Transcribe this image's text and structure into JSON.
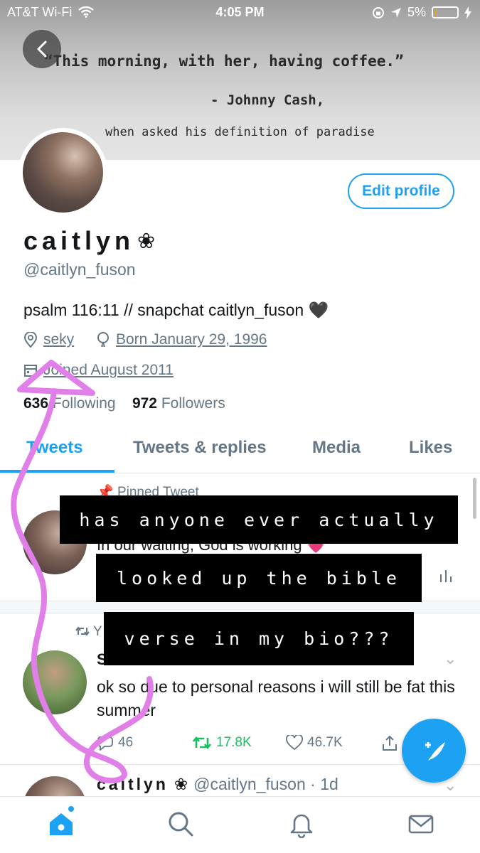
{
  "status_bar": {
    "carrier": "AT&T Wi-Fi",
    "time": "4:05 PM",
    "battery": "5%",
    "battery_level": 0.05
  },
  "header_image": {
    "quote": "“This morning, with her, having coffee.”",
    "attribution": "- Johnny Cash,",
    "context": "when asked his definition of paradise"
  },
  "profile": {
    "edit_button": "Edit profile",
    "name": "caitlyn",
    "name_symbol": "❀",
    "handle": "@caitlyn_fuson",
    "bio": "psalm 116:11 // snapchat caitlyn_fuson 🖤",
    "location": "seky",
    "birthday": "Born January 29, 1996",
    "joined": "Joined August 2011",
    "following_count": "636",
    "following_label": "Following",
    "followers_count": "972",
    "followers_label": "Followers"
  },
  "tabs": [
    {
      "label": "Tweets",
      "active": true
    },
    {
      "label": "Tweets & replies",
      "active": false
    },
    {
      "label": "Media",
      "active": false
    },
    {
      "label": "Likes",
      "active": false
    }
  ],
  "timeline": {
    "pinned": {
      "label": "Pinned Tweet",
      "text": "In our waiting, God is working 💗"
    },
    "retweet": {
      "label": "Y",
      "user": "S",
      "text": "ok so due to personal reasons i will still be fat this summer",
      "replies": "46",
      "retweets": "17.8K",
      "likes": "46.7K"
    },
    "third": {
      "name": "caitlyn",
      "handle": "@caitlyn_fuson · 1d"
    }
  },
  "overlay_caption": {
    "line1": "has anyone ever actually",
    "line2": "looked up the bible",
    "line3": "verse in my bio???"
  },
  "colors": {
    "accent": "#1da1f2",
    "retweet_green": "#17bf63",
    "doodle": "#e07fe8"
  },
  "icons": [
    "wifi-icon",
    "location-arrow-icon",
    "back-arrow-icon",
    "location-pin-icon",
    "balloon-icon",
    "calendar-icon",
    "pin-icon",
    "stats-icon",
    "retweet-icon",
    "chevron-down-icon",
    "reply-icon",
    "like-icon",
    "share-icon",
    "compose-icon",
    "home-icon",
    "search-icon",
    "bell-icon",
    "mail-icon"
  ]
}
